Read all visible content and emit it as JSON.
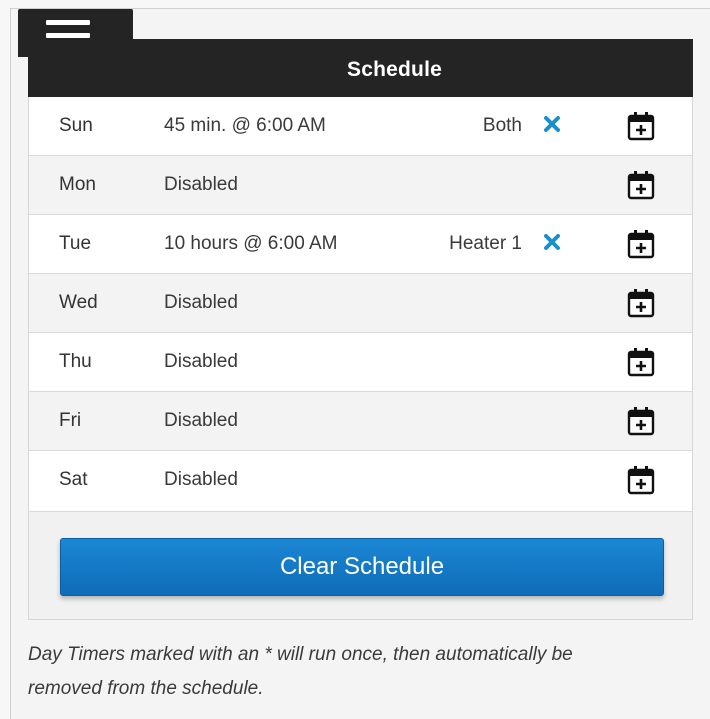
{
  "header": {
    "title": "Schedule"
  },
  "schedule": [
    {
      "day": "Sun",
      "info": "45 min. @ 6:00 AM",
      "target": "Both",
      "has_remove": true
    },
    {
      "day": "Mon",
      "info": "Disabled",
      "target": "",
      "has_remove": false
    },
    {
      "day": "Tue",
      "info": "10 hours @ 6:00 AM",
      "target": "Heater 1",
      "has_remove": true
    },
    {
      "day": "Wed",
      "info": "Disabled",
      "target": "",
      "has_remove": false
    },
    {
      "day": "Thu",
      "info": "Disabled",
      "target": "",
      "has_remove": false
    },
    {
      "day": "Fri",
      "info": "Disabled",
      "target": "",
      "has_remove": false
    },
    {
      "day": "Sat",
      "info": "Disabled",
      "target": "",
      "has_remove": false
    }
  ],
  "actions": {
    "clear_label": "Clear Schedule"
  },
  "footnote": "Day Timers marked with an * will run once, then automatically be removed from the schedule.",
  "colors": {
    "header_bg": "#242424",
    "accent_blue": "#1176c4",
    "remove_icon": "#1a8fc9"
  },
  "icons": {
    "menu": "hamburger-icon",
    "remove": "close-icon",
    "calendar": "calendar-add-icon"
  }
}
